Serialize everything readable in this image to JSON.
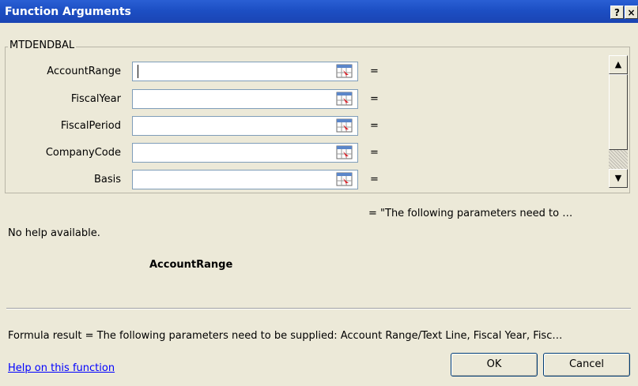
{
  "window": {
    "title": "Function Arguments",
    "help_button": "?",
    "close_button": "×"
  },
  "function_group": {
    "name": "MTDENDBAL",
    "arguments": [
      {
        "label": "AccountRange",
        "value": "",
        "result": "="
      },
      {
        "label": "FiscalYear",
        "value": "",
        "result": "="
      },
      {
        "label": "FiscalPeriod",
        "value": "",
        "result": "="
      },
      {
        "label": "CompanyCode",
        "value": "",
        "result": "="
      },
      {
        "label": "Basis",
        "value": "",
        "result": "="
      }
    ]
  },
  "result_preview": "= \"The following parameters need to …",
  "help_text": "No help available.",
  "current_argument": "AccountRange",
  "formula_result": "Formula result =   The following parameters need to be supplied: Account Range/Text Line, Fiscal Year, Fisc…",
  "help_link": "Help on this function",
  "buttons": {
    "ok": "OK",
    "cancel": "Cancel"
  },
  "icons": {
    "ref_button": "range-selector-icon",
    "scroll_up": "scroll-up-arrow-icon",
    "scroll_down": "scroll-down-arrow-icon"
  },
  "colors": {
    "titlebar": "#1d4fc4",
    "dialog_bg": "#ece9d8",
    "link": "#0000ff"
  }
}
